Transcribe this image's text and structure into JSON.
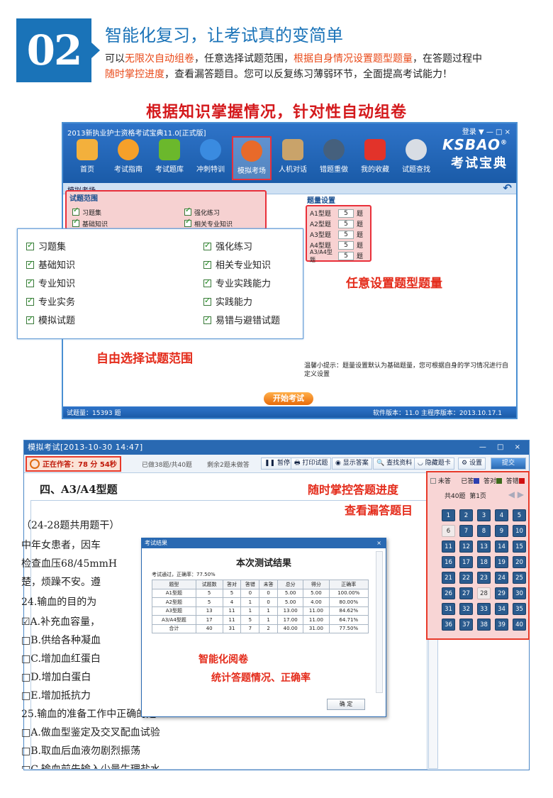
{
  "header": {
    "badge": "02",
    "title": "智能化复习，让考试真的变简单",
    "desc": [
      "可以",
      "无限次自动组卷",
      "，任意选择试题范围，",
      "根据自身情况设置题型题量",
      "，在答题过程中"
    ],
    "desc2": [
      "随时掌控进度",
      "，查看漏答题目。您可以反复练习薄弱环节，全面提高考试能力！"
    ],
    "section_title": "根据知识掌握情况，针对性自动组卷"
  },
  "app1": {
    "window_title": "2013新执业护士资格考试宝典11.0[正式版]",
    "window_controls": "登录  ▼  —  □  ×",
    "toolbar": [
      "首页",
      "考试指南",
      "考试题库",
      "冲刺特训",
      "模拟考场",
      "人机对话",
      "错题重做",
      "我的收藏",
      "试题查找"
    ],
    "brand_top": "KSBAO",
    "brand_reg": "®",
    "brand_bottom": "考试宝典",
    "page_name": "模拟考场",
    "scope_title": "试题范围",
    "scope_small": [
      "习题集",
      "强化练习",
      "基础知识",
      "相关专业知识"
    ],
    "type_title": "题量设置",
    "types": [
      {
        "label": "A1型题",
        "value": "5",
        "unit": "题"
      },
      {
        "label": "A2型题",
        "value": "5",
        "unit": "题"
      },
      {
        "label": "A3型题",
        "value": "5",
        "unit": "题"
      },
      {
        "label": "A4型题",
        "value": "5",
        "unit": "题"
      },
      {
        "label": "A3/A4型题",
        "value": "5",
        "unit": "题"
      }
    ],
    "scope_full": [
      "习题集",
      "强化练习",
      "基础知识",
      "相关专业知识",
      "专业知识",
      "专业实践能力",
      "专业实务",
      "实践能力",
      "模拟试题",
      "易错与避错试题"
    ],
    "tip": "温馨小提示：题量设置默认为基础题量，您可根据自身的学习情况进行自定义设置",
    "start_button": "开始考试",
    "status_left": "试题量：15393 题",
    "status_right": "软件版本：11.0  主程序版本：2013.10.17.1",
    "callout_type": "任意设置题型题量",
    "callout_scope": "自由选择试题范围"
  },
  "app2": {
    "window_title": "模拟考试[2013-10-30 14:47]",
    "window_controls": "—  □  ×",
    "timer": "正在作答：78  分 54秒",
    "progress": "已做38题/共40题",
    "remaining": "剩余2题未做答",
    "buttons": [
      "暂停",
      "打印试题",
      "显示答案",
      "查找资料",
      "隐藏题卡",
      "设置",
      "提交"
    ],
    "section": "四、A3/A4型题",
    "callout_progress": "随时掌控答题进度",
    "callout_missed": "查看漏答题目",
    "question_lines": [
      "（24-28题共用题干）",
      "中年女患者，因车",
      "检查血压68/45mmH",
      "楚，烦躁不安。遵",
      "24.输血的目的为",
      "☑A.补充血容量，",
      "□B.供给各种凝血",
      "□C.增加血红蛋白",
      "□D.增加白蛋白",
      "□E.增加抵抗力",
      "25.输血的准备工作中正确的是",
      "□A.做血型鉴定及交叉配血试验",
      "□B.取血后血液勿剧烈振荡",
      "□C.输血前先输入少量生理盐水"
    ],
    "legend": [
      "未答",
      "已答",
      "答对",
      "答错"
    ],
    "legend_colors": [
      "#ffffff",
      "#2b3fb0",
      "#3d6b1c",
      "#d01010"
    ],
    "card_header": [
      "共40题",
      "第1页"
    ],
    "card_white": [
      "6",
      "28"
    ],
    "dialog": {
      "title": "考试结果",
      "heading": "本次测试结果",
      "pass": "考试通过，正确率：77.50%",
      "headers": [
        "题型",
        "试题数",
        "答对",
        "答错",
        "未答",
        "总分",
        "得分",
        "正确率"
      ],
      "rows": [
        [
          "A1型题",
          "5",
          "5",
          "0",
          "0",
          "5.00",
          "5.00",
          "100.00%"
        ],
        [
          "A2型题",
          "5",
          "4",
          "1",
          "0",
          "5.00",
          "4.00",
          "80.00%"
        ],
        [
          "A3型题",
          "13",
          "11",
          "1",
          "1",
          "13.00",
          "11.00",
          "84.62%"
        ],
        [
          "A3/A4型题",
          "17",
          "11",
          "5",
          "1",
          "17.00",
          "11.00",
          "64.71%"
        ],
        [
          "合计",
          "40",
          "31",
          "7",
          "2",
          "40.00",
          "31.00",
          "77.50%"
        ]
      ],
      "callout1": "智能化阅卷",
      "callout2": "统计答题情况、正确率",
      "ok": "确  定"
    }
  }
}
